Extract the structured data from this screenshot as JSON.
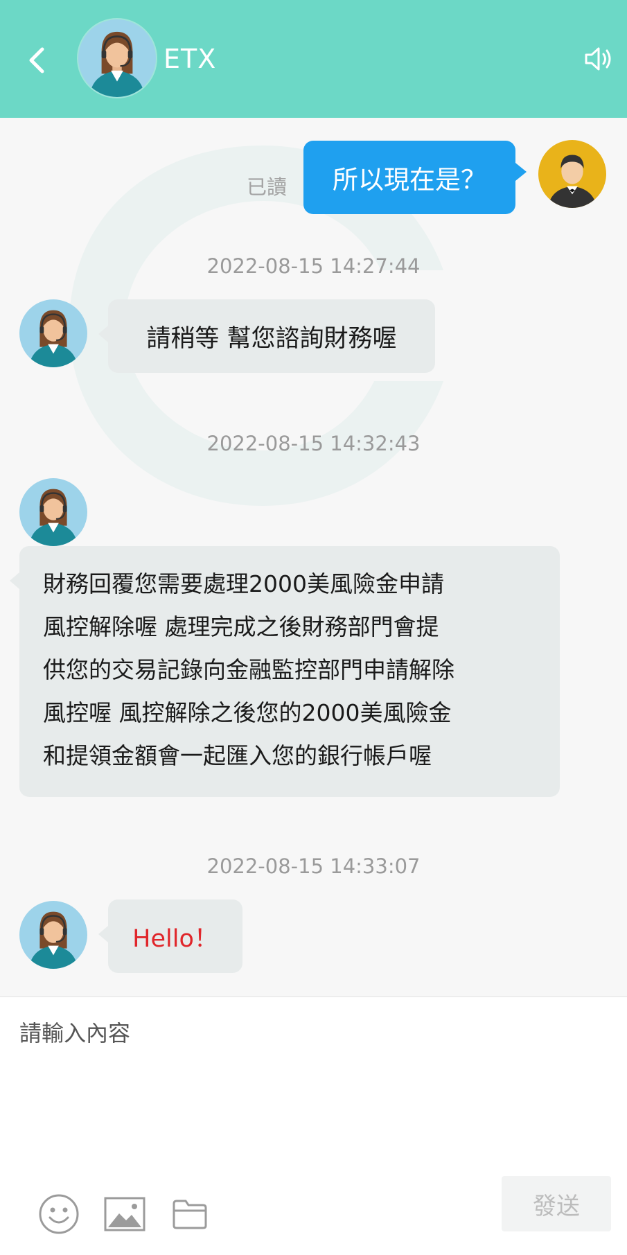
{
  "header": {
    "title": "ETX",
    "accent_color": "#6cd8c6"
  },
  "messages": [
    {
      "sender": "user",
      "text": "所以現在是？",
      "status": "已讀"
    },
    {
      "timestamp": "2022-08-15 14:27:44"
    },
    {
      "sender": "agent",
      "text": "請稍等 幫您諮詢財務喔"
    },
    {
      "timestamp": "2022-08-15 14:32:43"
    },
    {
      "sender": "agent",
      "lines": [
        "財務回覆您需要處理2000美風險金申請",
        "風控解除喔 處理完成之後財務部門會提",
        "供您的交易記錄向金融監控部門申請解除",
        "風控喔 風控解除之後您的2000美風險金",
        "和提領金額會一起匯入您的銀行帳戶喔"
      ]
    },
    {
      "timestamp": "2022-08-15 14:33:07"
    },
    {
      "sender": "agent",
      "text": "Hello！",
      "text_color": "#e0262b"
    }
  ],
  "composer": {
    "placeholder": "請輸入內容",
    "send_label": "發送",
    "tools": [
      "smiley-icon",
      "image-icon",
      "folder-icon"
    ]
  },
  "colors": {
    "user_bubble": "#1fa0ef",
    "agent_bubble": "#e7ebeb",
    "timestamp_text": "#9a9a9a"
  }
}
